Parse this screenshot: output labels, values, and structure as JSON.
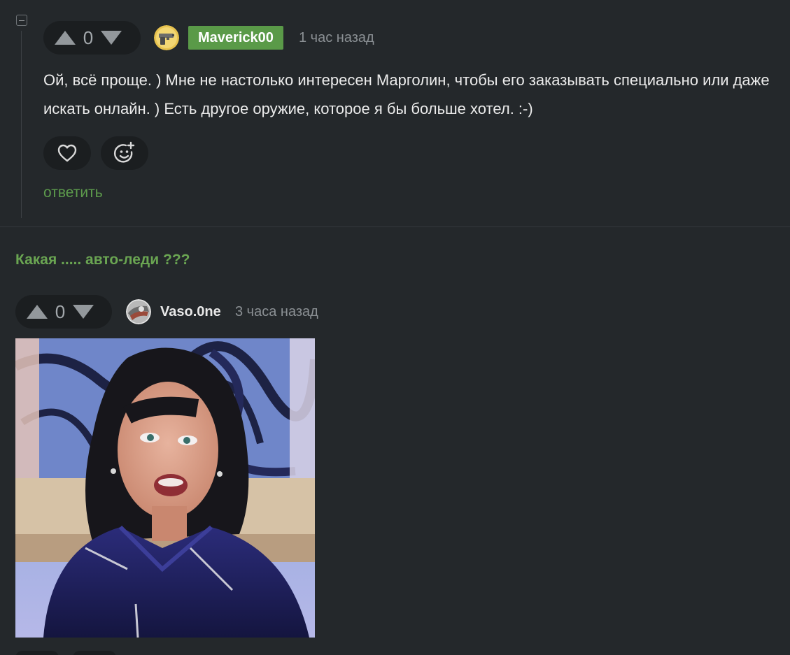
{
  "comment1": {
    "vote_count": "0",
    "username": "Maverick00",
    "time": "1 час назад",
    "text": "Ой, всё проще. ) Мне не настолько интересен Марголин, чтобы его заказывать специально или даже искать онлайн. ) Есть другое оружие, которое я бы больше хотел. :-)",
    "reply_label": "ответить",
    "badge_color": "#5a9a48"
  },
  "comment2": {
    "text": "Какая ..... авто-леди ???"
  },
  "comment3": {
    "vote_count": "0",
    "username": "Vaso.0ne",
    "time": "3 часа назад"
  },
  "icons": {
    "collapse": "collapse-icon",
    "upvote": "arrow-up-icon",
    "downvote": "arrow-down-icon",
    "like": "heart-icon",
    "reaction": "emoji-add-icon"
  }
}
